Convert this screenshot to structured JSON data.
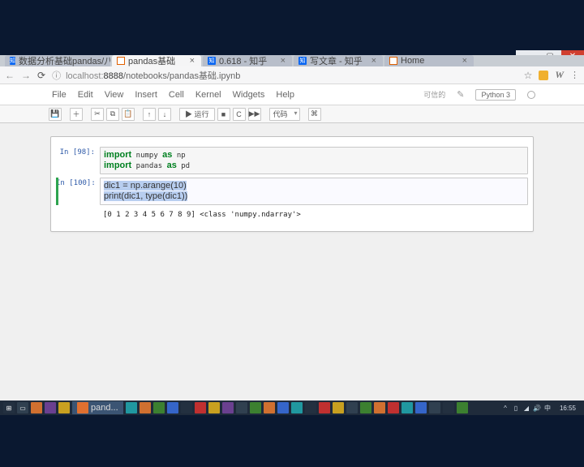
{
  "browser_tabs": [
    {
      "label": "数据分析基础pandas/八大常用",
      "active": false,
      "fav": "zhi"
    },
    {
      "label": "pandas基础",
      "active": true,
      "fav": "jup"
    },
    {
      "label": "0.618 - 知乎",
      "active": false,
      "fav": "zhi"
    },
    {
      "label": "写文章 - 知乎",
      "active": false,
      "fav": "zhi"
    },
    {
      "label": "Home",
      "active": false,
      "fav": "jup"
    }
  ],
  "address": {
    "host": "localhost",
    "port": "8888",
    "path": "/notebooks/pandas基础.ipynb"
  },
  "window_controls": {
    "min": "—",
    "max": "▢",
    "close": "✕"
  },
  "menus": [
    "File",
    "Edit",
    "View",
    "Insert",
    "Cell",
    "Kernel",
    "Widgets",
    "Help"
  ],
  "header": {
    "trusted": "可信的",
    "kernel": "Python 3"
  },
  "toolbar": {
    "save": "💾",
    "add": "＋",
    "cut": "✂",
    "copy": "⧉",
    "paste": "📋",
    "up": "↑",
    "down": "↓",
    "run": "▶ 运行",
    "stop": "■",
    "restart": "C",
    "ff": "▶▶",
    "celltype": "代码",
    "cmd": "⌘"
  },
  "cells": [
    {
      "id": "98",
      "prompt": "In  [98]:",
      "code_html": "<span class='kw'>import</span> numpy <span class='kw'>as</span> np<br><span class='kw'>import</span> pandas <span class='kw'>as</span> pd"
    },
    {
      "id": "100",
      "prompt": "In [100]:",
      "active": true,
      "code_html": "<span class='sel'>dic1 = np.arange(10)</span><br><span class='sel'>print(dic1, type(dic1))</span>",
      "output": "[0 1 2 3 4 5 6 7 8 9] <class 'numpy.ndarray'>"
    }
  ],
  "taskbar": {
    "active_app": "pand...",
    "clock": "16:55"
  }
}
